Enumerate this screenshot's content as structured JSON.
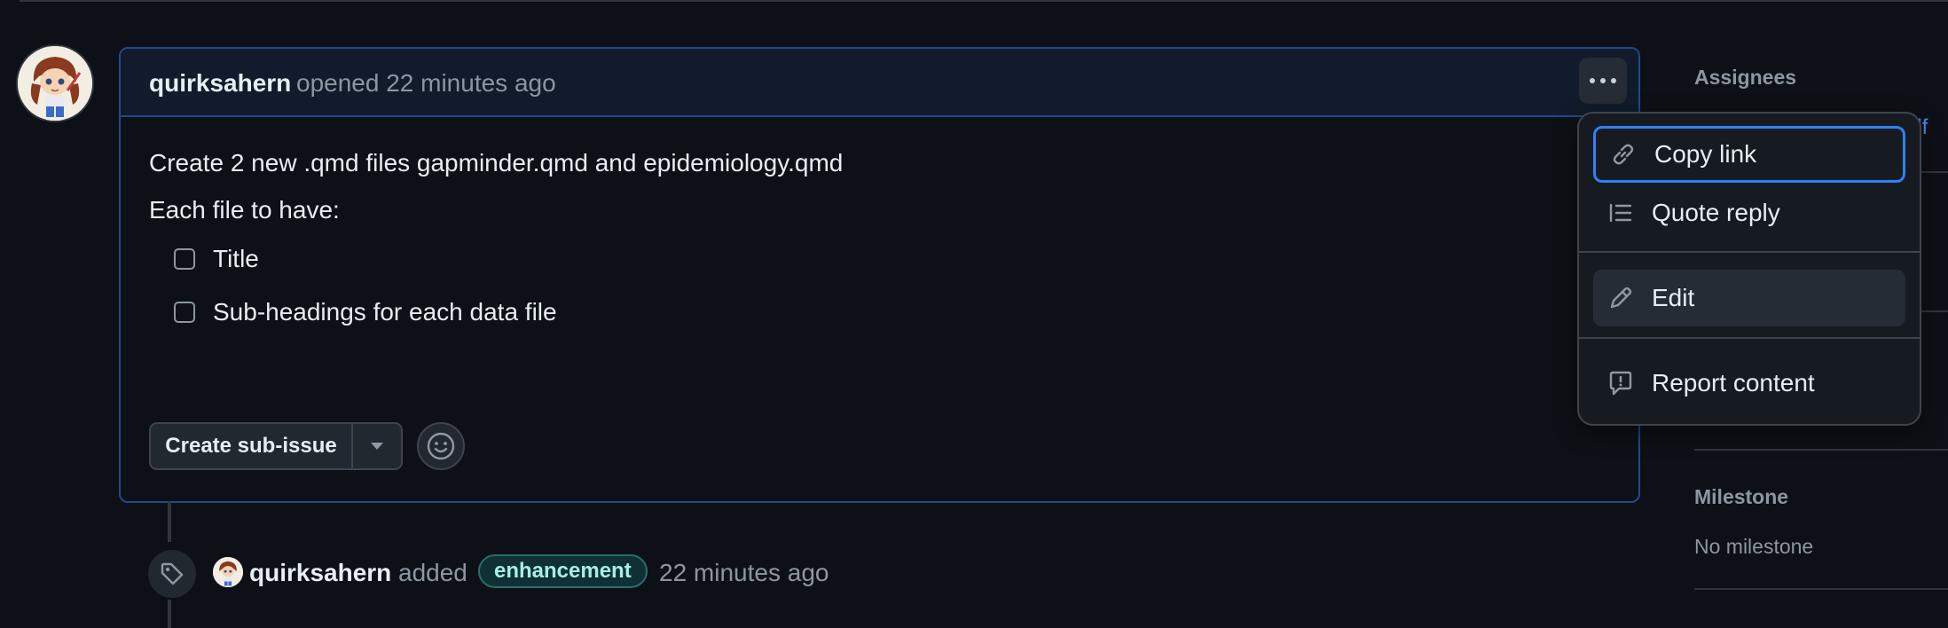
{
  "issue": {
    "author": "quirksahern",
    "opened_text": "opened 22 minutes ago",
    "menu_button": "···",
    "body": {
      "line1": "Create 2 new .qmd files gapminder.qmd and epidemiology.qmd",
      "line2": "Each file to have:",
      "tasks": [
        {
          "label": "Title",
          "checked": false
        },
        {
          "label": "Sub-headings for each data file",
          "checked": false
        }
      ]
    },
    "actions": {
      "create_subissue": "Create sub-issue"
    }
  },
  "timeline_event": {
    "author": "quirksahern",
    "action": "added",
    "label": "enhancement",
    "time": "22 minutes ago",
    "label_colors": {
      "bg": "#0f3034",
      "border": "#2b6e6a",
      "text": "#a6f0e4"
    }
  },
  "sidebar": {
    "assignees_heading": "Assignees",
    "assignees_link_partial": "elf",
    "milestone_heading": "Milestone",
    "milestone_value": "No milestone"
  },
  "comment_menu": {
    "items": [
      {
        "label": "Copy link",
        "icon": "link-icon",
        "state": "focused"
      },
      {
        "label": "Quote reply",
        "icon": "quote-icon",
        "state": "normal"
      },
      {
        "label": "Edit",
        "icon": "pencil-icon",
        "state": "hover"
      },
      {
        "label": "Report content",
        "icon": "report-icon",
        "state": "normal"
      }
    ]
  },
  "colors": {
    "background": "#0d1117",
    "accent": "#2f81f7",
    "muted_text": "#8d96a0"
  }
}
